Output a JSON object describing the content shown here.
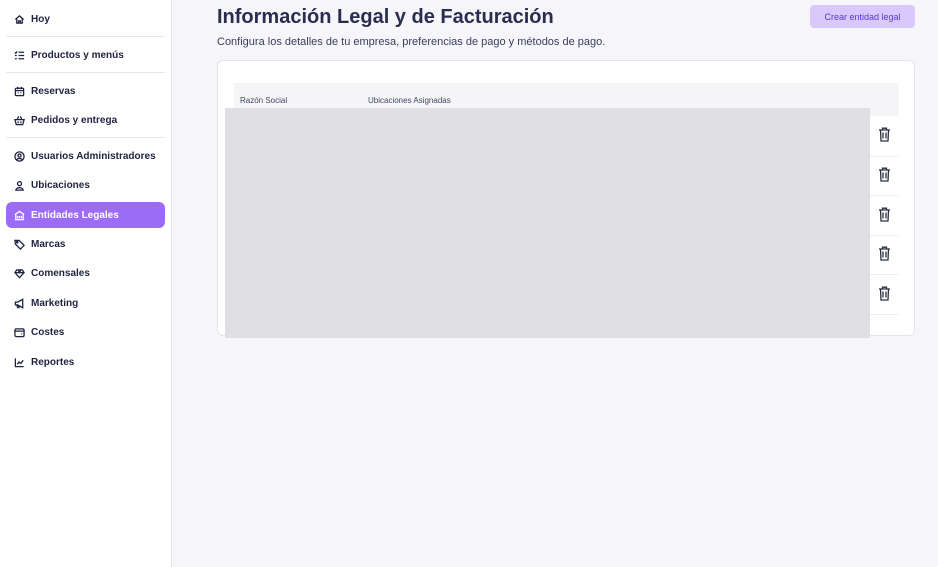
{
  "sidebar": {
    "items": [
      {
        "label": "Hoy",
        "icon": "home-icon"
      },
      {
        "label": "Productos y menús",
        "icon": "list-check-icon"
      },
      {
        "label": "Reservas",
        "icon": "calendar-icon"
      },
      {
        "label": "Pedidos y entrega",
        "icon": "basket-icon"
      },
      {
        "label": "Usuarios Administradores",
        "icon": "user-circle-icon"
      },
      {
        "label": "Ubicaciones",
        "icon": "user-location-icon"
      },
      {
        "label": "Entidades Legales",
        "icon": "building-icon"
      },
      {
        "label": "Marcas",
        "icon": "tag-icon"
      },
      {
        "label": "Comensales",
        "icon": "diamond-icon"
      },
      {
        "label": "Marketing",
        "icon": "megaphone-icon"
      },
      {
        "label": "Costes",
        "icon": "wallet-icon"
      },
      {
        "label": "Reportes",
        "icon": "chart-icon"
      }
    ],
    "active_item": "Entidades Legales",
    "accent_color": "#9d6cf7"
  },
  "main": {
    "title": "Información Legal y de Facturación",
    "subtitle": "Configura los detalles de tu empresa, preferencias de pago y métodos de pago.",
    "create_button_label": "Crear entidad legal",
    "table": {
      "columns": [
        "Razón Social",
        "Ubicaciones Asignadas"
      ],
      "row_count": 5,
      "row_action_icon": "trash-icon"
    }
  }
}
